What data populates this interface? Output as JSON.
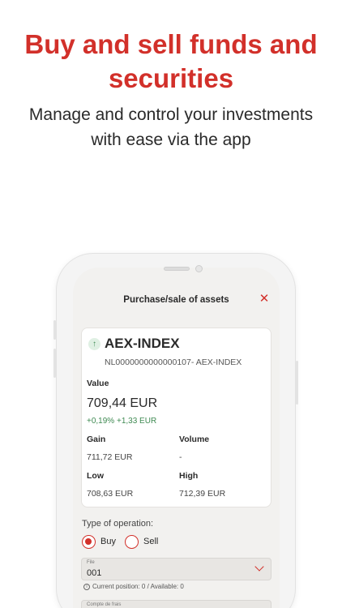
{
  "hero": {
    "title_line1": "Buy and sell funds and",
    "title_line2": "securities",
    "subtitle_line1": "Manage and control your investments",
    "subtitle_line2": "with ease via the app"
  },
  "modal": {
    "title": "Purchase/sale of assets",
    "close_symbol": "✕"
  },
  "asset": {
    "trend_icon": "arrow-up",
    "name": "AEX-INDEX",
    "identifier": "NL0000000000000107- AEX-INDEX",
    "value_label": "Value",
    "value": "709,44 EUR",
    "change": "+0,19% +1,33 EUR",
    "gain_label": "Gain",
    "gain": "711,72 EUR",
    "volume_label": "Volume",
    "volume": "-",
    "low_label": "Low",
    "low": "708,63 EUR",
    "high_label": "High",
    "high": "712,39 EUR"
  },
  "operation": {
    "label": "Type of operation:",
    "options": [
      {
        "label": "Buy",
        "selected": true
      },
      {
        "label": "Sell",
        "selected": false
      }
    ]
  },
  "file_select": {
    "caption": "File",
    "value": "001",
    "position_text": "Current position: 0 / Available: 0"
  },
  "fees_select": {
    "caption": "Compte de frais"
  },
  "colors": {
    "accent": "#d2302a",
    "positive": "#3f8a52"
  }
}
